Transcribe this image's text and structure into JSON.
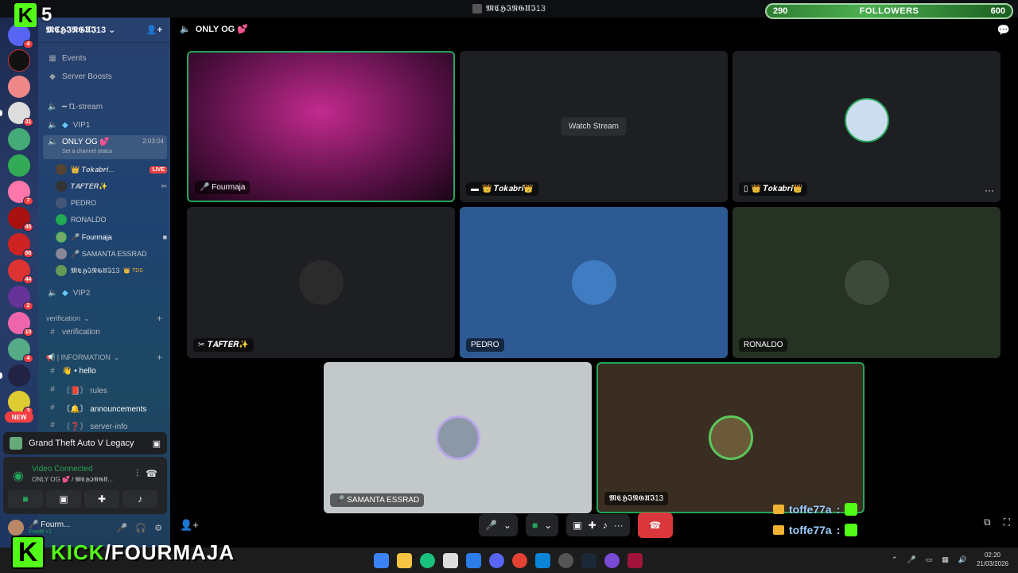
{
  "window": {
    "title": "𝕸𝕮𝕳𝕴𝕹𝕲𝖀𝕴13"
  },
  "overlay": {
    "kick_count": "5",
    "followers_left": "290",
    "followers_label": "FOLLOWERS",
    "followers_right": "600",
    "brand_k": "K",
    "brand_kick": "KICK",
    "brand_slash": "/FOURMAJA"
  },
  "server": {
    "name": "𝕸𝕮𝕳𝕴𝕹𝕲𝖀𝕴13"
  },
  "rail": {
    "badges": [
      "4",
      "31",
      "7",
      "45",
      "56",
      "44",
      "2",
      "10",
      "4",
      "3"
    ],
    "new_label": "NEW"
  },
  "sidebar": {
    "events": "Events",
    "boosts": "Server Boosts",
    "ch_f1": "━ f1-stream",
    "ch_vip1": "VIP1",
    "ch_onlyog": "ONLY OG 💕",
    "ch_onlyog_status": "Set a channel status",
    "ch_onlyog_time": "2:03:04",
    "members": [
      {
        "name": "👑 𝑻𝒐𝒌𝒂𝒃𝒓𝒊..."
      },
      {
        "name": "𝑻𝑨𝑭𝑻𝑬𝑹✨"
      },
      {
        "name": "PEDRO"
      },
      {
        "name": "RONALDO"
      },
      {
        "name": "🎤 Fourmaja"
      },
      {
        "name": "🎤 SAMANTA ESSRAD"
      },
      {
        "name": "𝕸𝕮𝕳𝕴𝕹𝕲𝖀𝕴13"
      }
    ],
    "live": "LIVE",
    "tds": "👑 TDS",
    "ch_vip2": "VIP2",
    "cat_verification": "verification",
    "ch_verification": "verification",
    "cat_information": "📢 | INFORMATION",
    "ch_hello": "👋 • hello",
    "ch_rules": "〔📕〕 rules",
    "ch_announcements": "〔🔔〕 announcements",
    "ch_serverinfo": "〔❓〕 server-info"
  },
  "activity": {
    "game": "Grand Theft Auto V Legacy"
  },
  "voice": {
    "status": "Video Connected",
    "location": "ONLY OG 💕 / 𝕸𝕮𝕳𝕴𝕹𝕲𝖀..."
  },
  "user": {
    "name": "🎤 Fourm...",
    "sub": "FiveM +1"
  },
  "main": {
    "channel": "ONLY OG 💕",
    "watch_stream": "Watch Stream",
    "tiles": {
      "fourmaja": "🎤 Fourmaja",
      "tokabri_stream": "👑 𝑻𝒐𝒌𝒂𝒃𝒓𝒊👑",
      "tokabri_cam": "👑 𝑻𝒐𝒌𝒂𝒃𝒓𝒊👑",
      "tafter": "𝑻𝑨𝑭𝑻𝑬𝑹✨",
      "pedro": "PEDRO",
      "ronaldo": "RONALDO",
      "samanta": "🎤 SAMANTA ESSRAD",
      "mchin": "𝕸𝕮𝕳𝕴𝕹𝕲𝖀𝕴13"
    }
  },
  "chat": [
    {
      "user": "toffe77a",
      "sep": ":"
    },
    {
      "user": "toffe77a",
      "sep": ":"
    }
  ],
  "taskbar": {
    "time": "02:20",
    "date": "21/03/2026"
  },
  "colors": {
    "accent_green": "#53fc18",
    "discord_online": "#23a55a",
    "hangup": "#da373c",
    "pedro_bg": "#2d5a92",
    "ronaldo_bg": "#263224",
    "samanta_bg": "#c3c8cb",
    "mchin_bg": "#3a2e22"
  }
}
